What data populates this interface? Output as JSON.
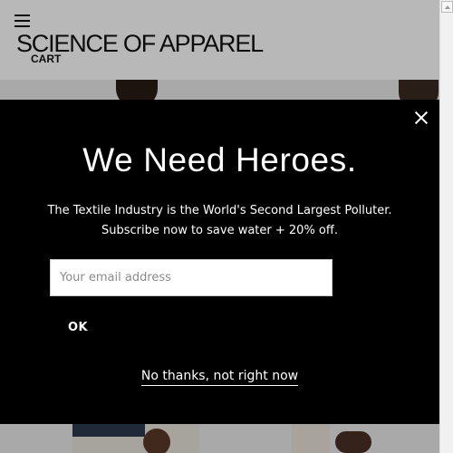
{
  "header": {
    "logo": "SCIENCE OF APPAREL",
    "cart_label": "CART"
  },
  "popup": {
    "headline": "We Need Heroes.",
    "subline_1": "The Textile Industry is the World's Second Largest Polluter.",
    "subline_2": "Subscribe now to save water + 20% off.",
    "email_placeholder": "Your email address",
    "email_value": "",
    "submit_label": "OK",
    "dismiss_label": "No thanks, not right now"
  },
  "icons": {
    "menu": "hamburger-menu-icon",
    "close": "close-icon",
    "scroll_up": "scroll-up-arrow-icon"
  },
  "colors": {
    "popup_background": "#000000",
    "popup_text": "#ffffff",
    "page_background": "#ffffff"
  }
}
